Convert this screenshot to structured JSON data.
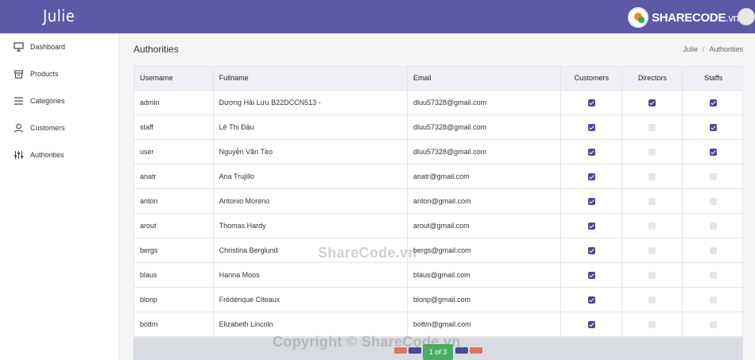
{
  "app": {
    "brand": "Julie"
  },
  "watermark": {
    "logo_text": "SHARECODE",
    "logo_suffix": ".vn",
    "center_text": "ShareCode.vn",
    "bottom_text": "Copyright © ShareCode.vn"
  },
  "sidebar": {
    "items": [
      {
        "label": "Dashboard",
        "icon": "monitor-icon"
      },
      {
        "label": "Products",
        "icon": "box-icon"
      },
      {
        "label": "Categories",
        "icon": "list-icon"
      },
      {
        "label": "Customers",
        "icon": "user-icon"
      },
      {
        "label": "Authorities",
        "icon": "sliders-icon"
      }
    ]
  },
  "page": {
    "title": "Authorities",
    "breadcrumb": [
      "Julie",
      "Authorities"
    ]
  },
  "table": {
    "columns": [
      "Username",
      "Fullname",
      "Email",
      "Customers",
      "Directors",
      "Staffs"
    ],
    "rows": [
      {
        "username": "admin",
        "fullname": "Dương Hải Lưu B22DCCN513 -",
        "email": "dluu57328@gmail.com",
        "customers": true,
        "directors": true,
        "staffs": true
      },
      {
        "username": "staff",
        "fullname": "Lê Thị Đậu",
        "email": "dluu57328@gmail.com",
        "customers": true,
        "directors": false,
        "staffs": true
      },
      {
        "username": "user",
        "fullname": "Nguyễn Văn Tèo",
        "email": "dluu57328@gmail.com",
        "customers": true,
        "directors": false,
        "staffs": true
      },
      {
        "username": "anatr",
        "fullname": "Ana Trujillo",
        "email": "anatr@gmail.com",
        "customers": true,
        "directors": false,
        "staffs": false
      },
      {
        "username": "anton",
        "fullname": "Antonio Moreno",
        "email": "anton@gmail.com",
        "customers": true,
        "directors": false,
        "staffs": false
      },
      {
        "username": "arout",
        "fullname": "Thomas Hardy",
        "email": "arout@gmail.com",
        "customers": true,
        "directors": false,
        "staffs": false
      },
      {
        "username": "bergs",
        "fullname": "Christina Berglund",
        "email": "bergs@gmail.com",
        "customers": true,
        "directors": false,
        "staffs": false
      },
      {
        "username": "blaus",
        "fullname": "Hanna Moos",
        "email": "blaus@gmail.com",
        "customers": true,
        "directors": false,
        "staffs": false
      },
      {
        "username": "blonp",
        "fullname": "Frédérique Citeaux",
        "email": "blonp@gmail.com",
        "customers": true,
        "directors": false,
        "staffs": false
      },
      {
        "username": "bottm",
        "fullname": "Elizabeth Lincoln",
        "email": "bottm@gmail.com",
        "customers": true,
        "directors": false,
        "staffs": false
      }
    ]
  },
  "pagination": {
    "current_label": "1 of 3"
  },
  "colors": {
    "topbar": "#5e58a8",
    "checked": "#4b4a8f",
    "pager_current": "#4aae64",
    "pager_nav_red": "#e0745f",
    "pager_nav_blue": "#4b4a8f"
  }
}
